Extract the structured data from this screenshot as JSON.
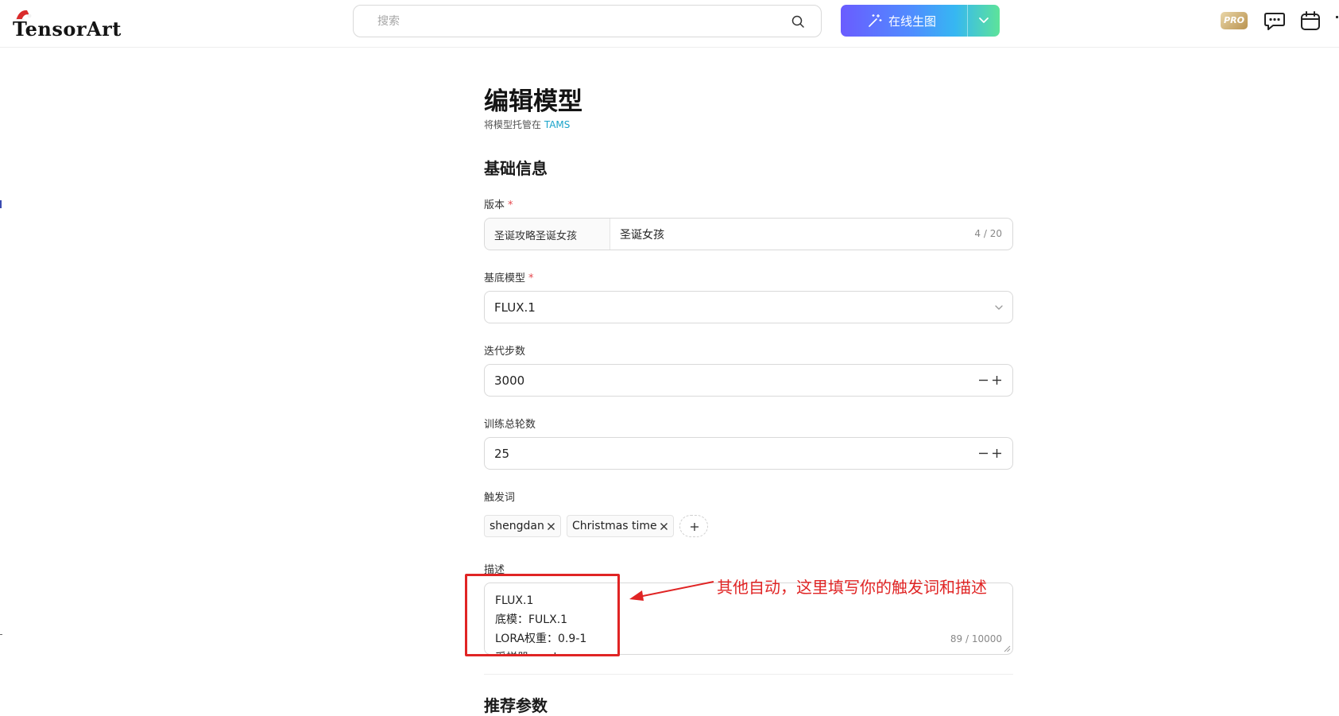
{
  "header": {
    "logo_text": "TensorArt",
    "search_placeholder": "搜索",
    "generate_label": "在线生图",
    "pro_label": "PRO"
  },
  "page": {
    "title": "编辑模型",
    "subtitle_prefix": "将模型托管在 ",
    "subtitle_link": "TAMS",
    "section_basic": "基础信息",
    "section_next": "推荐参数"
  },
  "form": {
    "version": {
      "label": "版本",
      "required": "*",
      "prefix": "圣诞攻略圣诞女孩",
      "value": "圣诞女孩",
      "counter": "4 / 20"
    },
    "base_model": {
      "label": "基底模型",
      "required": "*",
      "value": "FLUX.1"
    },
    "steps": {
      "label": "迭代步数",
      "value": "3000"
    },
    "epochs": {
      "label": "训练总轮数",
      "value": "25"
    },
    "trigger_words": {
      "label": "触发词",
      "tags": [
        "shengdan",
        "Christmas time"
      ]
    },
    "description": {
      "label": "描述",
      "lines": [
        "FLUX.1",
        "底模：FULX.1",
        "LORA权重：0.9-1",
        "采样器：euler"
      ],
      "counter": "89 / 10000"
    }
  },
  "annotation": {
    "text": "其他自动，这里填写你的触发词和描述",
    "color": "#e02424"
  },
  "colors": {
    "accent_link": "#1aa3c9",
    "required": "#e5484d",
    "gradient_start": "#6a5cff",
    "gradient_end": "#5de39a"
  }
}
